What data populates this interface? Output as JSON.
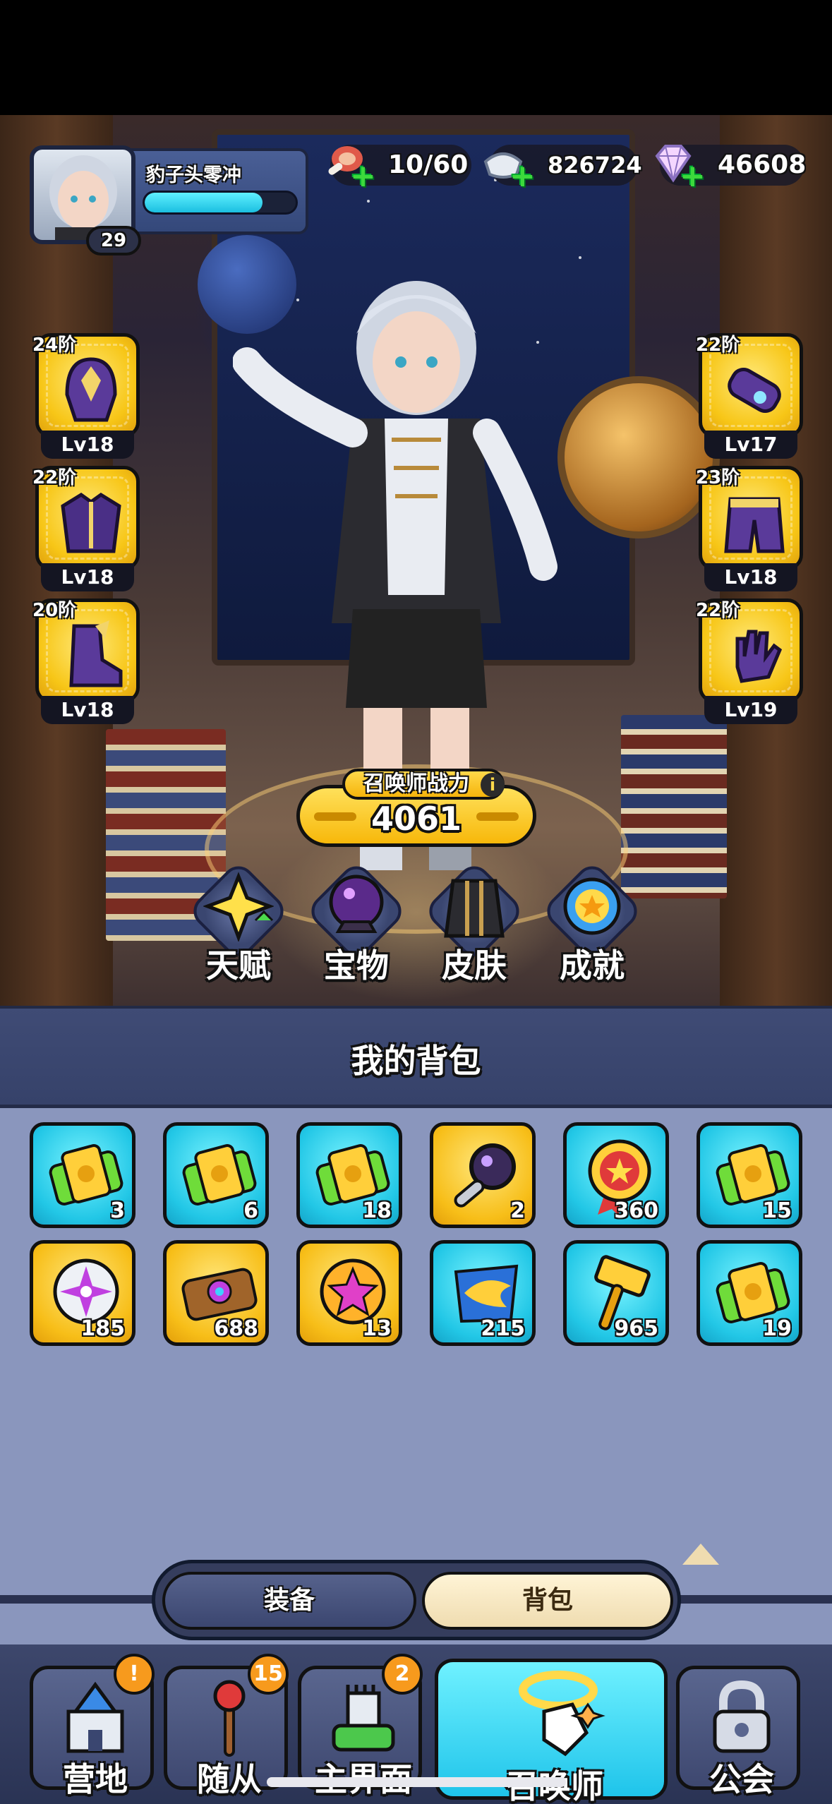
{
  "player": {
    "name": "豹子头零冲",
    "level": "29",
    "exp_fraction": 0.78
  },
  "resources": {
    "stamina": {
      "icon": "meat-icon",
      "value": "10/60"
    },
    "silver": {
      "icon": "silver-ingot-icon",
      "value": "826724"
    },
    "diamond": {
      "icon": "diamond-icon",
      "value": "46608"
    }
  },
  "equipment_left": [
    {
      "grade": "24阶",
      "level": "Lv18",
      "icon": "helmet-icon"
    },
    {
      "grade": "22阶",
      "level": "Lv18",
      "icon": "armor-icon"
    },
    {
      "grade": "20阶",
      "level": "Lv18",
      "icon": "boots-icon"
    }
  ],
  "equipment_right": [
    {
      "grade": "22阶",
      "level": "Lv17",
      "icon": "bracer-icon"
    },
    {
      "grade": "23阶",
      "level": "Lv18",
      "icon": "pants-icon"
    },
    {
      "grade": "22阶",
      "level": "Lv19",
      "icon": "gauntlet-icon"
    }
  ],
  "power": {
    "label": "召唤师战力",
    "value": "4061"
  },
  "features": [
    {
      "label": "天赋",
      "icon": "talent-star-icon"
    },
    {
      "label": "宝物",
      "icon": "crystal-ball-icon"
    },
    {
      "label": "皮肤",
      "icon": "cloak-icon"
    },
    {
      "label": "成就",
      "icon": "medal-icon"
    }
  ],
  "bag": {
    "title": "我的背包",
    "items": [
      {
        "count": "3",
        "icon": "ticket-icon",
        "bg": "cyan"
      },
      {
        "count": "6",
        "icon": "ticket-icon",
        "bg": "cyan"
      },
      {
        "count": "18",
        "icon": "ticket-icon",
        "bg": "cyan"
      },
      {
        "count": "2",
        "icon": "magnifier-icon",
        "bg": "gold"
      },
      {
        "count": "360",
        "icon": "badge-medal-icon",
        "bg": "cyan"
      },
      {
        "count": "15",
        "icon": "ticket-icon",
        "bg": "cyan"
      },
      {
        "count": "185",
        "icon": "compass-gem-icon",
        "bg": "gold"
      },
      {
        "count": "688",
        "icon": "scroll-ticket-icon",
        "bg": "gold"
      },
      {
        "count": "13",
        "icon": "star-coin-icon",
        "bg": "gold"
      },
      {
        "count": "215",
        "icon": "dragon-emblem-icon",
        "bg": "cyan"
      },
      {
        "count": "965",
        "icon": "hammer-icon",
        "bg": "cyan"
      },
      {
        "count": "19",
        "icon": "ticket-icon",
        "bg": "cyan"
      }
    ]
  },
  "tabs": {
    "equipment": "装备",
    "bag": "背包"
  },
  "nav": [
    {
      "label": "营地",
      "icon": "castle-icon",
      "badge": "!"
    },
    {
      "label": "随从",
      "icon": "staff-icon",
      "badge": "15"
    },
    {
      "label": "主界面",
      "icon": "tower-icon",
      "badge": "2"
    },
    {
      "label": "召唤师",
      "icon": "summon-hand-icon",
      "badge": ""
    },
    {
      "label": "公会",
      "icon": "lock-icon",
      "badge": ""
    }
  ],
  "colors": {
    "cyan_item": "#22c7e6",
    "gold_item": "#f7be18",
    "panel": "#8a96bd",
    "header": "#3f4b75"
  }
}
